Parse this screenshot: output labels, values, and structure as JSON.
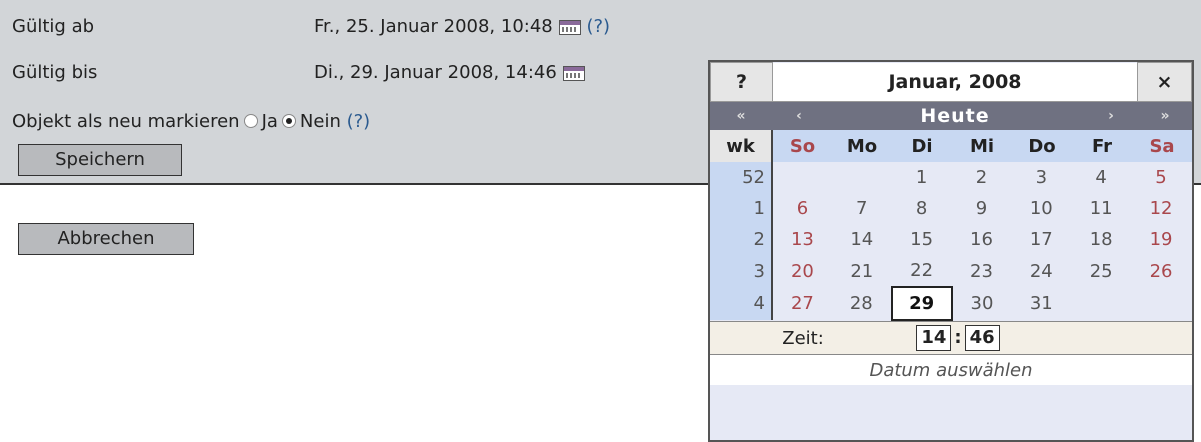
{
  "form": {
    "valid_from_label": "Gültig ab",
    "valid_from_value": "Fr., 25. Januar 2008, 10:48",
    "valid_to_label": "Gültig bis",
    "valid_to_value": "Di., 29. Januar 2008, 14:46",
    "help_text": "(?)",
    "mark_new_label": "Objekt als neu markieren",
    "radio_yes": "Ja",
    "radio_no": "Nein",
    "save_button": "Speichern",
    "cancel_button": "Abbrechen"
  },
  "calendar": {
    "help": "?",
    "title": "Januar, 2008",
    "close": "×",
    "nav_prev_year": "«",
    "nav_prev_month": "‹",
    "today": "Heute",
    "nav_next_month": "›",
    "nav_next_year": "»",
    "week_header": "wk",
    "weekdays": [
      "So",
      "Mo",
      "Di",
      "Mi",
      "Do",
      "Fr",
      "Sa"
    ],
    "weeks": [
      {
        "wk": "52",
        "days": [
          "",
          "",
          "1",
          "2",
          "3",
          "4",
          "5"
        ]
      },
      {
        "wk": "1",
        "days": [
          "6",
          "7",
          "8",
          "9",
          "10",
          "11",
          "12"
        ]
      },
      {
        "wk": "2",
        "days": [
          "13",
          "14",
          "15",
          "16",
          "17",
          "18",
          "19"
        ]
      },
      {
        "wk": "3",
        "days": [
          "20",
          "21",
          "22",
          "23",
          "24",
          "25",
          "26"
        ]
      },
      {
        "wk": "4",
        "days": [
          "27",
          "28",
          "29",
          "30",
          "31",
          "",
          ""
        ]
      }
    ],
    "selected_day": "29",
    "time_label": "Zeit:",
    "hour": "14",
    "time_sep": ":",
    "minute": "46",
    "footer": "Datum auswählen"
  },
  "icons": [
    "calendar-icon",
    "radio-unchecked",
    "radio-checked"
  ],
  "colors": {
    "form_bg": "#d2d5d8",
    "nav_bg": "#6f7181",
    "weekend": "#a9474c",
    "header_blue": "#c8d8f2",
    "link": "#2a5a8f"
  }
}
